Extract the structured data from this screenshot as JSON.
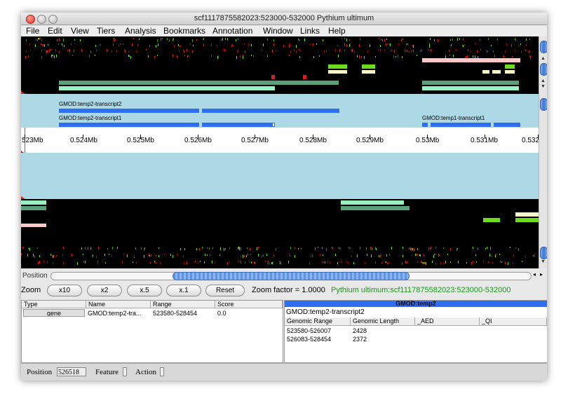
{
  "window": {
    "title": "scf1117875582023:523000-532000 Pythium ultimum"
  },
  "menu": [
    "File",
    "Edit",
    "View",
    "Tiers",
    "Analysis",
    "Bookmarks",
    "Annotation",
    "Window",
    "Links",
    "Help"
  ],
  "tracks": {
    "transcript_labels": [
      "GMOD:temp2-transcript2",
      "GMOD:temp2-transcript1",
      "GMOD:temp1-transcript1"
    ]
  },
  "ruler": {
    "ticks": [
      "523Mb",
      "0.524Mb",
      "0.525Mb",
      "0.526Mb",
      "0.527Mb",
      "0.528Mb",
      "0.529Mb",
      "0.53Mb",
      "0.531Mb",
      "0.532"
    ]
  },
  "position_label": "Position",
  "zoom": {
    "label": "Zoom",
    "buttons": [
      "x10",
      "x2",
      "x.5",
      "x.1"
    ],
    "reset": "Reset",
    "factor_text": "Zoom factor = 1.0000",
    "location_text": "Pythium ultimum:scf1117875582023:523000-532000",
    "location_color": "#1a9a1a"
  },
  "left_table": {
    "headers": [
      "Type",
      "Name",
      "Range",
      "Score"
    ],
    "rows": [
      {
        "type": "gene",
        "name": "GMOD:temp2-tra...",
        "range": "523580-528454",
        "score": "0.0"
      }
    ]
  },
  "right_panel": {
    "header": "GMOD:temp2",
    "header_color": "#2d6ff0",
    "subtitle": "GMOD:temp2-transcript2",
    "headers": [
      "Genomic Range",
      "Genomic Length",
      "_AED",
      "_QI"
    ],
    "rows": [
      {
        "range": "523580-526007",
        "length": "2428",
        "aed": "",
        "qi": ""
      },
      {
        "range": "526083-528454",
        "length": "2372",
        "aed": "",
        "qi": ""
      }
    ]
  },
  "status": {
    "position_label": "Position",
    "position_value": "526518",
    "feature_label": "Feature",
    "action_label": "Action"
  }
}
